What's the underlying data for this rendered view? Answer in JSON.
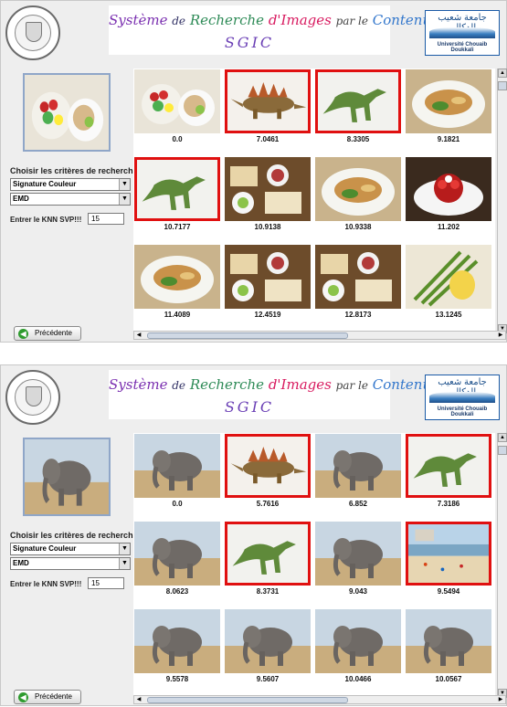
{
  "app": {
    "title_parts": [
      "Système",
      "de",
      "Recherche",
      "d'",
      "Images",
      "par le",
      "Contenu"
    ],
    "acronym": "SGIC",
    "right_logo_arabic": "جامعة شعيب الدكالي",
    "right_logo_french": "Université Chouaib Doukkali"
  },
  "labels": {
    "criteria": "Choisir les critères de recherche",
    "knn": "Entrer le KNN SVP!!!",
    "back_button": "Précédente"
  },
  "colors": {
    "selected_border": "#e01010",
    "panel_bg": "#eeeeee",
    "title_accent": "#7a2fb0"
  },
  "panels": [
    {
      "signature": "Signature Couleur",
      "metric": "EMD",
      "knn_value": "15",
      "query_image": "food-platter",
      "results": [
        {
          "value": "0.0",
          "image": "food-platter",
          "selected": false
        },
        {
          "value": "7.0461",
          "image": "stegosaurus",
          "selected": true
        },
        {
          "value": "8.3305",
          "image": "dinosaur",
          "selected": true
        },
        {
          "value": "9.1821",
          "image": "food-plate",
          "selected": false
        },
        {
          "value": "10.7177",
          "image": "dinosaur",
          "selected": true
        },
        {
          "value": "10.9138",
          "image": "food-buffet",
          "selected": false
        },
        {
          "value": "10.9338",
          "image": "food-plate",
          "selected": false
        },
        {
          "value": "11.202",
          "image": "dessert",
          "selected": false
        },
        {
          "value": "11.4089",
          "image": "food-plate",
          "selected": false
        },
        {
          "value": "12.4519",
          "image": "food-buffet",
          "selected": false
        },
        {
          "value": "12.8173",
          "image": "food-buffet",
          "selected": false
        },
        {
          "value": "13.1245",
          "image": "asparagus",
          "selected": false
        }
      ]
    },
    {
      "signature": "Signature Couleur",
      "metric": "EMD",
      "knn_value": "15",
      "query_image": "elephant",
      "results": [
        {
          "value": "0.0",
          "image": "elephant",
          "selected": false
        },
        {
          "value": "5.7616",
          "image": "stegosaurus",
          "selected": true
        },
        {
          "value": "6.852",
          "image": "elephant",
          "selected": false
        },
        {
          "value": "7.3186",
          "image": "dinosaur",
          "selected": true
        },
        {
          "value": "8.0623",
          "image": "elephant",
          "selected": false
        },
        {
          "value": "8.3731",
          "image": "dinosaur",
          "selected": true
        },
        {
          "value": "9.043",
          "image": "elephant",
          "selected": false
        },
        {
          "value": "9.5494",
          "image": "beach",
          "selected": true
        },
        {
          "value": "9.5578",
          "image": "elephant",
          "selected": false
        },
        {
          "value": "9.5607",
          "image": "elephant",
          "selected": false
        },
        {
          "value": "10.0466",
          "image": "elephant",
          "selected": false
        },
        {
          "value": "10.0567",
          "image": "elephant",
          "selected": false
        }
      ]
    }
  ]
}
